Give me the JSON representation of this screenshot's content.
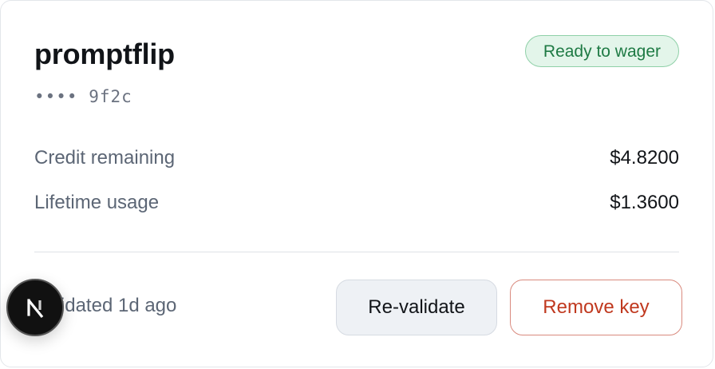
{
  "card": {
    "name": "promptflip",
    "masked_key": "•••• 9f2c",
    "status_badge": "Ready to wager",
    "stats": [
      {
        "label": "Credit remaining",
        "value": "$4.8200"
      },
      {
        "label": "Lifetime usage",
        "value": "$1.3600"
      }
    ],
    "validated": "Validated 1d ago",
    "buttons": {
      "revalidate": "Re-validate",
      "remove": "Remove key"
    }
  },
  "overlay": {
    "icon": "nextjs-logo-icon"
  },
  "colors": {
    "badge_bg": "#e3f5ea",
    "badge_text": "#1e7a44",
    "danger": "#c0391f"
  }
}
